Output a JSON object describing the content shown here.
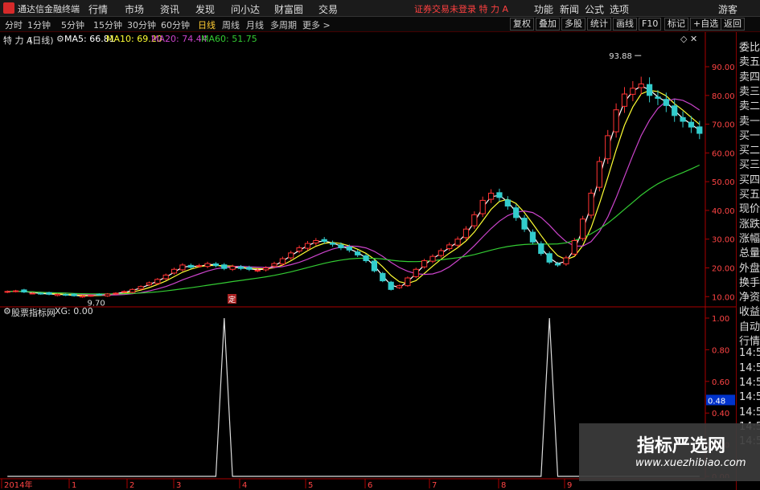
{
  "app": {
    "title": "通达信金融终端"
  },
  "menu": [
    "行情",
    "市场",
    "资讯",
    "发现",
    "问小达",
    "财富圈",
    "交易"
  ],
  "warning": "证券交易未登录  特 力 A",
  "right_menu": [
    "功能",
    "新闻",
    "公式",
    "选项",
    "游客"
  ],
  "periods": [
    "分时",
    "1分钟",
    "5分钟",
    "15分钟",
    "30分钟",
    "60分钟",
    "日线",
    "周线",
    "月线",
    "多周期",
    "更多 >"
  ],
  "active_period": "日线",
  "toolbar": [
    "复权",
    "叠加",
    "多股",
    "统计",
    "画线",
    "F10",
    "标记",
    "+自选",
    "返回"
  ],
  "stock": {
    "name": "特 力 A",
    "cycle": "(日线)"
  },
  "ma": [
    {
      "label": "MA5: 66.81",
      "color": "#ffffff"
    },
    {
      "label": "MA10: 69.20",
      "color": "#ffff33"
    },
    {
      "label": "MA20: 74.44",
      "color": "#cc44cc"
    },
    {
      "label": "MA60: 51.75",
      "color": "#33cc33"
    }
  ],
  "indicator": {
    "name": "股票指标网",
    "value": "XG: 0.00"
  },
  "annotations": {
    "high": "93.88",
    "low": "9.70",
    "marker": "定"
  },
  "side_panel": [
    "委比",
    "卖五",
    "卖四",
    "卖三",
    "卖二",
    "卖一",
    "买一",
    "买二",
    "买三",
    "买四",
    "买五",
    "现价",
    "涨跌",
    "涨幅",
    "总量",
    "外盘",
    "换手",
    "净资",
    "收益",
    "自动",
    "行情",
    "14:5",
    "14:5",
    "14:5",
    "14:5",
    "14:5",
    "14:5",
    "14:5"
  ],
  "watermark": {
    "title": "指标严选网",
    "url": "www.xuezhibiao.com"
  },
  "colors": {
    "up": "#ff3333",
    "down": "#33cccc",
    "axis": "#aa0000",
    "tick": "#ff4444"
  },
  "chart_data": [
    {
      "type": "candlestick",
      "title": "特 力 A (日线)",
      "y_ticks": [
        10.0,
        20.0,
        30.0,
        40.0,
        50.0,
        60.0,
        70.0,
        80.0,
        90.0
      ],
      "ylim": [
        7,
        97
      ],
      "x_ticks": [
        "2014年",
        "1",
        "2",
        "3",
        "4",
        "5",
        "6",
        "7",
        "8",
        "9"
      ],
      "close": [
        11.8,
        12.0,
        11.6,
        11.2,
        11.0,
        10.8,
        10.8,
        10.5,
        10.3,
        10.2,
        10.4,
        10.6,
        10.9,
        11.2,
        11.8,
        12.5,
        13.5,
        14.8,
        16.0,
        17.5,
        19.5,
        21.0,
        20.2,
        20.8,
        21.5,
        20.8,
        19.8,
        20.5,
        19.8,
        19.5,
        19.2,
        20.0,
        21.5,
        23.2,
        25.2,
        27.0,
        28.5,
        29.5,
        29.2,
        28.2,
        27.0,
        26.2,
        24.5,
        22.5,
        19.0,
        15.5,
        12.5,
        13.8,
        16.5,
        19.5,
        22.5,
        24.0,
        26.0,
        28.0,
        30.0,
        33.5,
        38.5,
        43.5,
        46.0,
        44.5,
        41.5,
        37.5,
        33.5,
        29.0,
        25.0,
        22.0,
        21.0,
        23.5,
        29.5,
        37.0,
        46.0,
        57.0,
        66.0,
        75.0,
        80.5,
        82.5,
        84.0,
        80.0,
        79.0,
        76.5,
        73.0,
        71.0,
        69.0,
        66.8
      ],
      "high": 93.88,
      "low": 9.7,
      "ma": {
        "MA5": 66.81,
        "MA10": 69.2,
        "MA20": 74.44,
        "MA60": 51.75
      }
    },
    {
      "type": "line",
      "title": "股票指标网",
      "series": [
        {
          "name": "XG",
          "values": [
            0,
            0,
            0,
            0,
            0,
            0,
            0,
            0,
            0,
            0,
            0,
            0,
            0,
            0,
            0,
            0,
            0,
            0,
            0,
            0,
            0,
            0,
            0,
            0,
            0,
            0,
            1,
            0,
            0,
            0,
            0,
            0,
            0,
            0,
            0,
            0,
            0,
            0,
            0,
            0,
            0,
            0,
            0,
            0,
            0,
            0,
            0,
            0,
            0,
            0,
            0,
            0,
            0,
            0,
            0,
            0,
            0,
            0,
            0,
            0,
            0,
            0,
            0,
            0,
            0,
            1,
            0,
            0,
            0,
            0,
            0,
            0,
            0,
            0,
            0,
            0,
            0,
            0,
            0,
            0,
            0,
            0,
            0,
            0
          ]
        }
      ],
      "y_ticks": [
        0.0,
        0.2,
        0.4,
        0.6,
        0.8,
        1.0
      ],
      "ylim": [
        0,
        1
      ],
      "current": "0.48"
    }
  ]
}
